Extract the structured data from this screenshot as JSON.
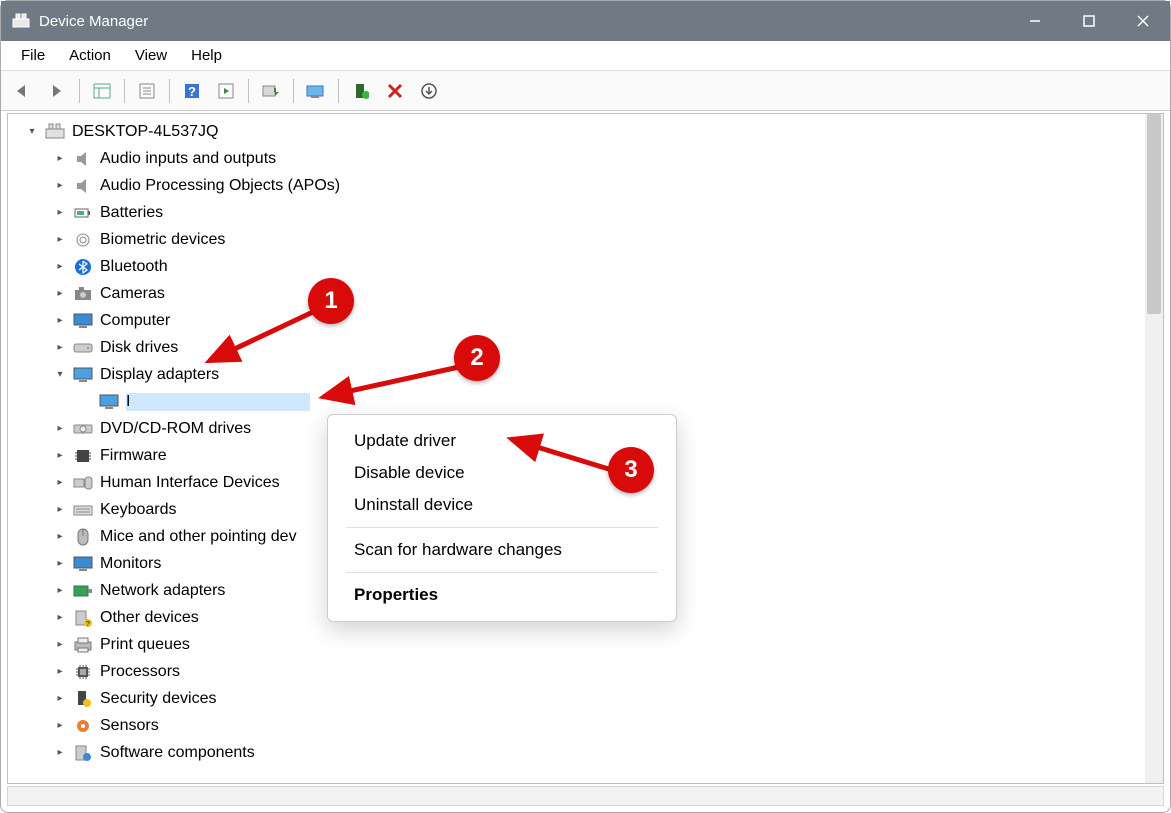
{
  "window": {
    "title": "Device Manager"
  },
  "menu": {
    "file": "File",
    "action": "Action",
    "view": "View",
    "help": "Help"
  },
  "tree": {
    "root": "DESKTOP-4L537JQ",
    "audio_io": "Audio inputs and outputs",
    "apo": "Audio Processing Objects (APOs)",
    "batteries": "Batteries",
    "biometric": "Biometric devices",
    "bluetooth": "Bluetooth",
    "cameras": "Cameras",
    "computer": "Computer",
    "disk": "Disk drives",
    "display": "Display adapters",
    "display_child": "I",
    "dvd": "DVD/CD-ROM drives",
    "firmware": "Firmware",
    "hid": "Human Interface Devices",
    "keyboards": "Keyboards",
    "mice": "Mice and other pointing dev",
    "monitors": "Monitors",
    "network": "Network adapters",
    "other": "Other devices",
    "print": "Print queues",
    "processors": "Processors",
    "security": "Security devices",
    "sensors": "Sensors",
    "software": "Software components"
  },
  "context": {
    "update": "Update driver",
    "disable": "Disable device",
    "uninstall": "Uninstall device",
    "scan": "Scan for hardware changes",
    "properties": "Properties"
  },
  "annotations": {
    "a1": "1",
    "a2": "2",
    "a3": "3"
  }
}
